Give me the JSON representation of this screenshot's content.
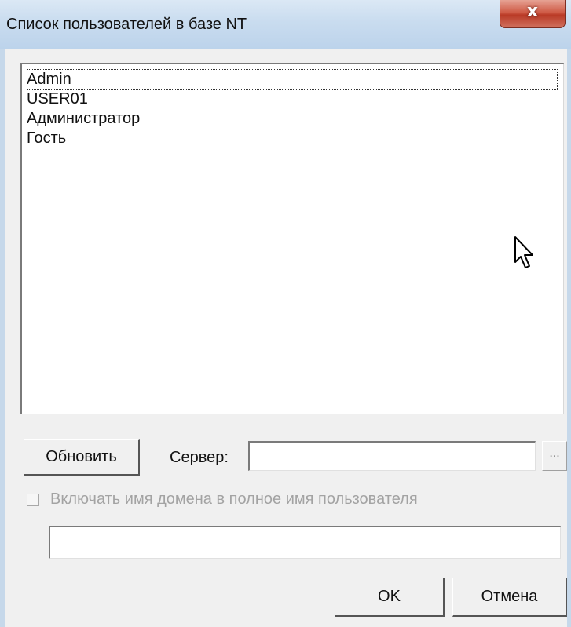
{
  "window": {
    "title": "Список пользователей в базе NT",
    "close_symbol": "x"
  },
  "users_list": {
    "items": [
      "Admin",
      "USER01",
      "Администратор",
      "Гость"
    ],
    "selected_index": 0
  },
  "buttons": {
    "refresh": "Обновить",
    "browse": "...",
    "ok": "OK",
    "cancel": "Отмена"
  },
  "server": {
    "label": "Сервер:",
    "value": ""
  },
  "include_domain": {
    "label": "Включать имя домена в полное имя пользователя",
    "checked": false,
    "enabled": false
  },
  "full_name": {
    "value": ""
  },
  "colors": {
    "title_bar": "#c9dcef",
    "close_button": "#cf5b46",
    "disabled_text": "#a3a3a3"
  },
  "icons": {
    "close": "close-icon",
    "cursor": "mouse-pointer-icon"
  }
}
